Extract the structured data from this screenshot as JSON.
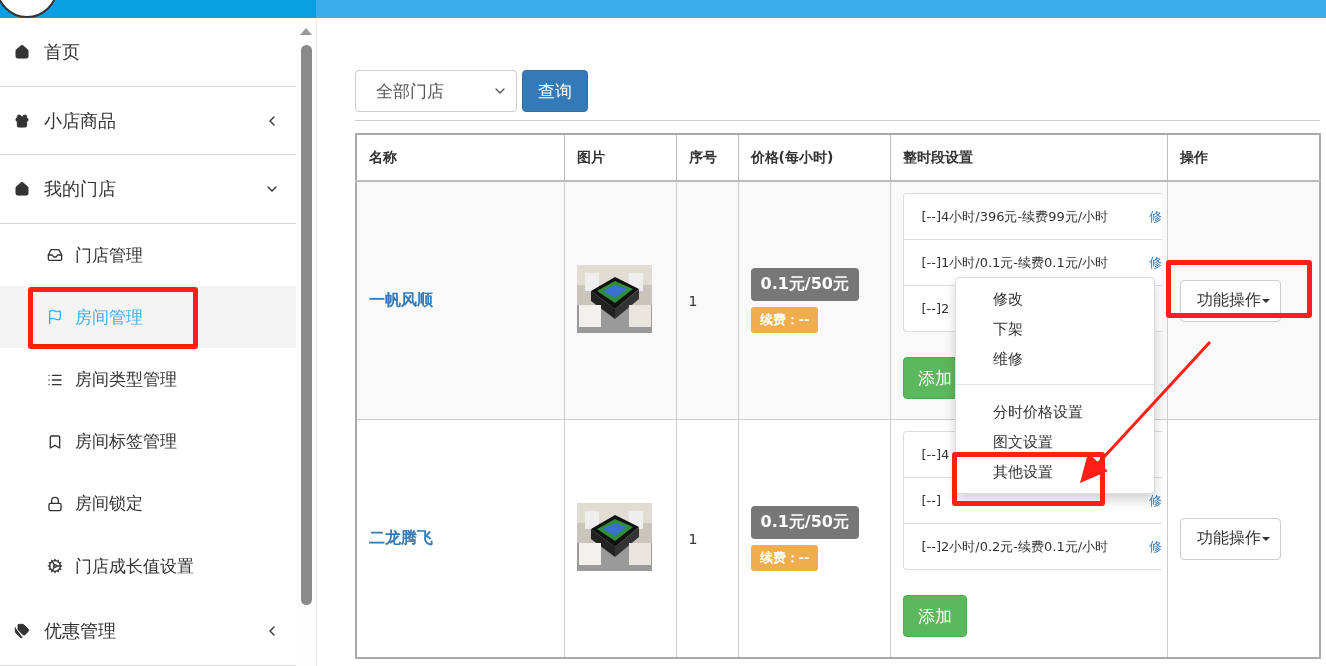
{
  "sidebar": {
    "items": [
      {
        "label": "首页",
        "selected": false
      },
      {
        "label": "小店商品",
        "selected": false,
        "expanded": false
      },
      {
        "label": "我的门店",
        "selected": false,
        "expanded": true,
        "children": [
          {
            "label": "门店管理",
            "selected": false
          },
          {
            "label": "房间管理",
            "selected": true
          },
          {
            "label": "房间类型管理",
            "selected": false
          },
          {
            "label": "房间标签管理",
            "selected": false
          },
          {
            "label": "房间锁定",
            "selected": false
          },
          {
            "label": "门店成长值设置",
            "selected": false
          }
        ]
      },
      {
        "label": "优惠管理",
        "selected": false,
        "expanded": false
      }
    ]
  },
  "filter": {
    "store_select": "全部门店",
    "query_button": "查询"
  },
  "table": {
    "columns": [
      "名称",
      "图片",
      "序号",
      "价格(每小时)",
      "整时段设置",
      "操作"
    ],
    "rows": [
      {
        "name": "一帆风顺",
        "seq": "1",
        "price": "0.1元/50元",
        "renew": "续费：--",
        "slots": [
          {
            "text": "[--]4小时/396元-续费99元/小时",
            "link": "修"
          },
          {
            "text": "[--]1小时/0.1元-续费0.1元/小时",
            "link": "修"
          },
          {
            "text": "[--]2"
          }
        ],
        "add_button": "添加",
        "action_button": "功能操作"
      },
      {
        "name": "二龙腾飞",
        "seq": "1",
        "price": "0.1元/50元",
        "renew": "续费：--",
        "slots": [
          {
            "text": "[--]4"
          },
          {
            "text": "[--]",
            "link": "修"
          },
          {
            "text": "[--]2小时/0.2元-续费0.1元/小时",
            "link": "修"
          }
        ],
        "add_button": "添加",
        "action_button": "功能操作"
      }
    ]
  },
  "dropdown_menu": {
    "groups": [
      [
        "修改",
        "下架",
        "维修"
      ],
      [
        "分时价格设置",
        "图文设置",
        "其他设置"
      ]
    ]
  }
}
